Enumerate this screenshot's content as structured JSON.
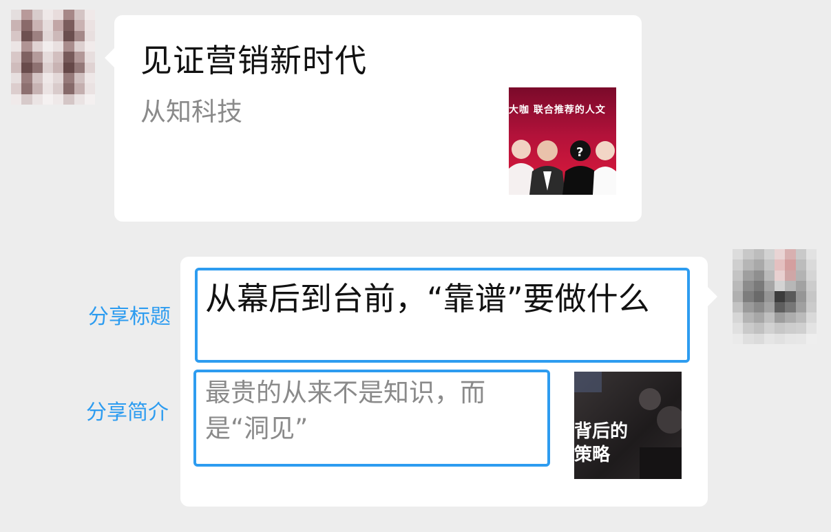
{
  "messages": [
    {
      "side": "left",
      "avatar": "blurred-avatar",
      "card": {
        "title": "见证营销新时代",
        "source": "从知科技",
        "thumbnail": {
          "banner_text": "大咖 联合推荐的人文",
          "dominant_color": "#c8143a"
        }
      }
    },
    {
      "side": "right",
      "avatar": "blurred-avatar",
      "card": {
        "title": "从幕后到台前，“靠谱”要做什么",
        "description": "最贵的从来不是知识，而是“洞见”",
        "thumbnail": {
          "line1": "背后的",
          "line2": "策略",
          "dominant_color": "#2a2627"
        }
      }
    }
  ],
  "annotations": {
    "title_label": "分享标题",
    "desc_label": "分享简介",
    "highlight_color": "#2d9cf0"
  }
}
